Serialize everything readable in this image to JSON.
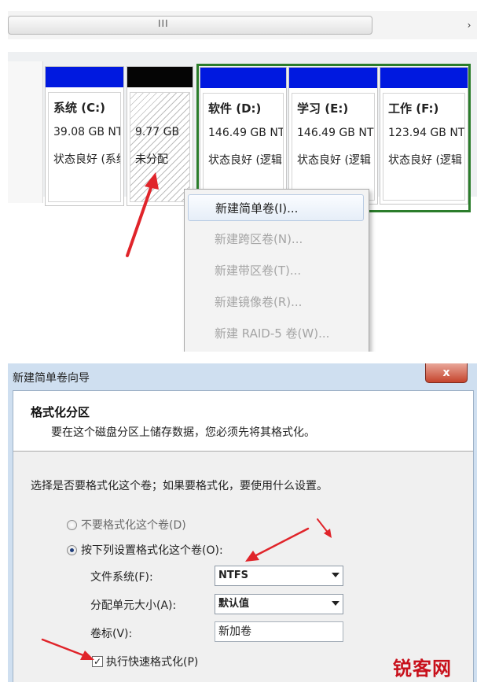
{
  "disk_view": {
    "scroll_grip": "III",
    "scroll_arrow": "›",
    "volumes": [
      {
        "name": "系统 (C:)",
        "size": "39.08 GB NT",
        "state": "状态良好 (系统",
        "bar_color": "#0019e0"
      },
      {
        "name": "",
        "size": "9.77 GB",
        "state": "未分配",
        "bar_color": "#050505"
      },
      {
        "name": "软件 (D:)",
        "size": "146.49 GB NTI",
        "state": "状态良好 (逻辑",
        "bar_color": "#0019e0"
      },
      {
        "name": "学习 (E:)",
        "size": "146.49 GB NTF",
        "state": "状态良好 (逻辑",
        "bar_color": "#0019e0"
      },
      {
        "name": "工作 (F:)",
        "size": "123.94 GB NTI",
        "state": "状态良好 (逻辑",
        "bar_color": "#0019e0"
      }
    ],
    "extended_frame_color": "#2b7d2b",
    "arrow_color": "#e0242a"
  },
  "context_menu": {
    "items": [
      {
        "label": "新建简单卷(I)...",
        "enabled": true
      },
      {
        "label": "新建跨区卷(N)...",
        "enabled": false
      },
      {
        "label": "新建带区卷(T)...",
        "enabled": false
      },
      {
        "label": "新建镜像卷(R)...",
        "enabled": false
      },
      {
        "label": "新建 RAID-5 卷(W)...",
        "enabled": false
      }
    ]
  },
  "wizard": {
    "title": "新建简单卷向导",
    "close_glyph": "x",
    "header_title": "格式化分区",
    "header_desc": "要在这个磁盘分区上储存数据，您必须先将其格式化。",
    "instruction": "选择是否要格式化这个卷；如果要格式化，要使用什么设置。",
    "option_no_format": "不要格式化这个卷(D)",
    "option_format": "按下列设置格式化这个卷(O):",
    "fs_label": "文件系统(F):",
    "fs_value": "NTFS",
    "alloc_label": "分配单元大小(A):",
    "alloc_value": "默认值",
    "volume_label_label": "卷标(V):",
    "volume_label_value": "新加卷",
    "quick_format_label": "执行快速格式化(P)",
    "quick_format_checked": "✓"
  },
  "watermark": "锐客网"
}
